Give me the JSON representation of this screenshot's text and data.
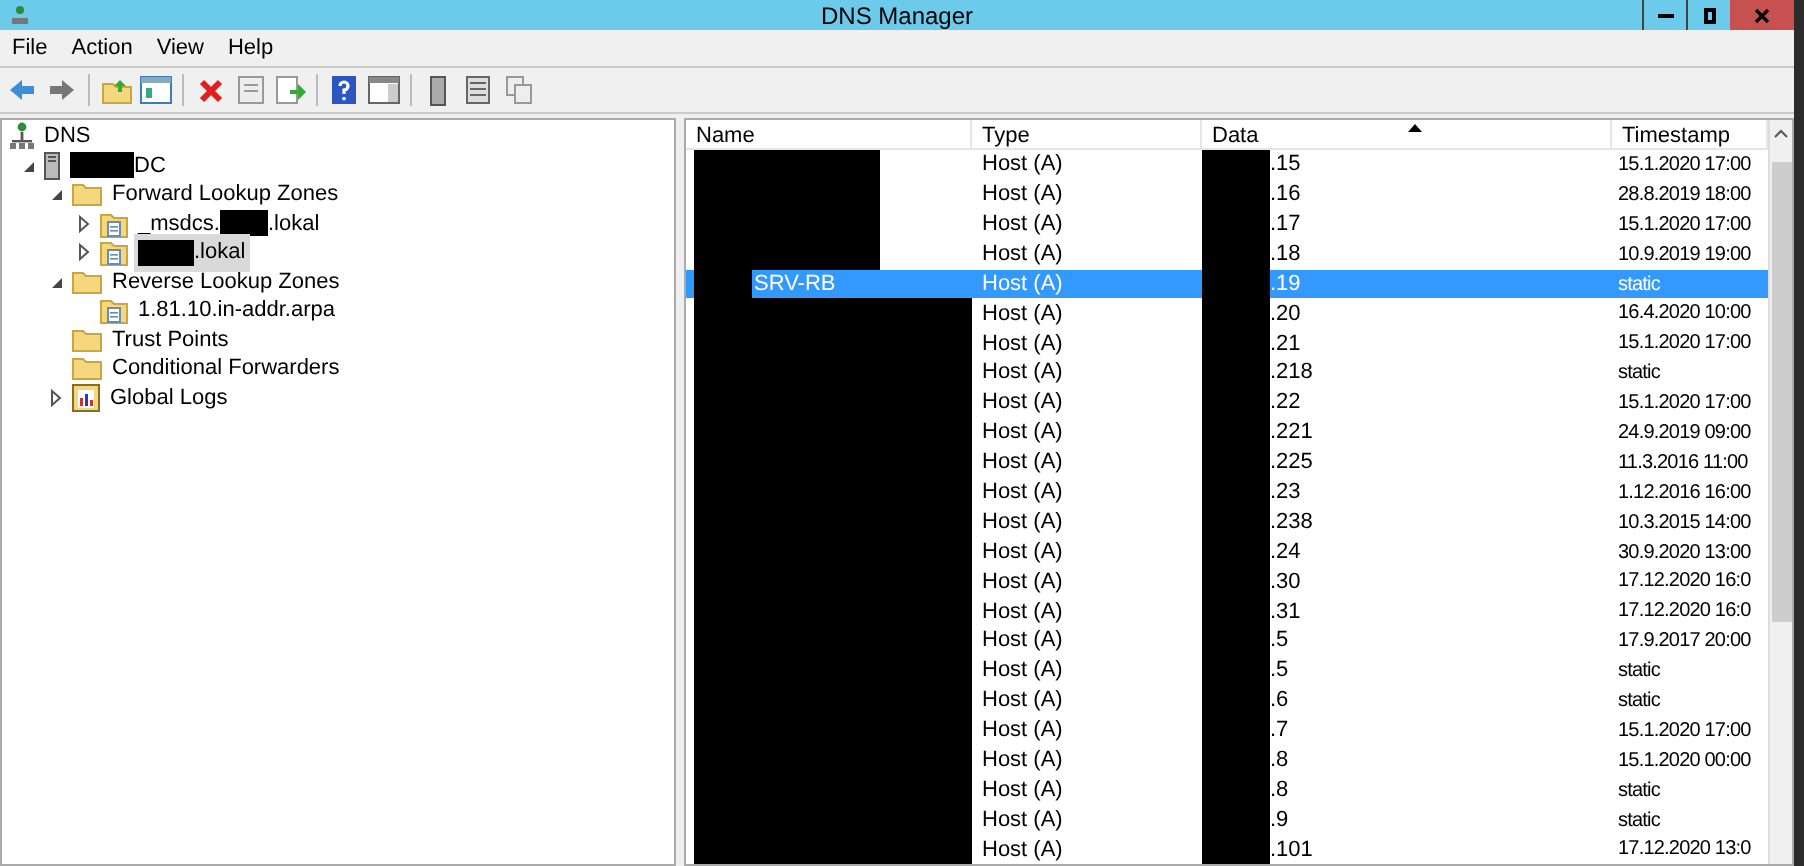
{
  "window": {
    "title": "DNS Manager"
  },
  "menu": [
    "File",
    "Action",
    "View",
    "Help"
  ],
  "tree": [
    {
      "label_parts": [
        "DNS"
      ],
      "kind": "dns",
      "redacted_start": false,
      "children": [
        {
          "label_parts": [
            "DC"
          ],
          "kind": "server",
          "redacted_start": true,
          "expanded": true,
          "children": [
            {
              "label_parts": [
                "Forward Lookup Zones"
              ],
              "kind": "folder",
              "redacted_start": false,
              "expanded": true,
              "children": [
                {
                  "label_parts": [
                    "_msdcs.",
                    ".lokal"
                  ],
                  "redacted_start": false,
                  "kind": "zone",
                  "expanded": false,
                  "selected": false
                },
                {
                  "label_parts": [
                    ".lokal"
                  ],
                  "redacted_start": true,
                  "kind": "zone",
                  "expanded": false,
                  "selected": true
                }
              ]
            },
            {
              "label_parts": [
                "Reverse Lookup Zones"
              ],
              "kind": "folder",
              "redacted_start": false,
              "expanded": true,
              "children": [
                {
                  "label_parts": [
                    "1.81.10.in-addr.arpa"
                  ],
                  "kind": "zone",
                  "redacted_start": false,
                  "selected": false
                }
              ]
            },
            {
              "label_parts": [
                "Trust Points"
              ],
              "kind": "folder",
              "redacted_start": false
            },
            {
              "label_parts": [
                "Conditional Forwarders"
              ],
              "kind": "folder",
              "redacted_start": false
            },
            {
              "label_parts": [
                "Global Logs"
              ],
              "kind": "logs",
              "redacted_start": false,
              "expanded": false
            }
          ]
        }
      ]
    }
  ],
  "table": {
    "columns": [
      "Name",
      "Type",
      "Data",
      "Timestamp"
    ],
    "rows": [
      {
        "type": "Host (A)",
        "data": ".15",
        "timestamp": "15.1.2020 17:00",
        "selected": false
      },
      {
        "type": "Host (A)",
        "data": ".16",
        "timestamp": "28.8.2019 18:00",
        "selected": false
      },
      {
        "type": "Host (A)",
        "data": ".17",
        "timestamp": "15.1.2020 17:00",
        "selected": false
      },
      {
        "type": "Host (A)",
        "data": ".18",
        "timestamp": "10.9.2019 19:00",
        "selected": false
      },
      {
        "name": "SRV-RB",
        "type": "Host (A)",
        "data": ".19",
        "timestamp": "static",
        "selected": true
      },
      {
        "type": "Host (A)",
        "data": ".20",
        "timestamp": "16.4.2020 10:00",
        "selected": false
      },
      {
        "type": "Host (A)",
        "data": ".21",
        "timestamp": "15.1.2020 17:00",
        "selected": false
      },
      {
        "type": "Host (A)",
        "data": ".218",
        "timestamp": "static",
        "selected": false
      },
      {
        "type": "Host (A)",
        "data": ".22",
        "timestamp": "15.1.2020 17:00",
        "selected": false
      },
      {
        "type": "Host (A)",
        "data": ".221",
        "timestamp": "24.9.2019 09:00",
        "selected": false
      },
      {
        "type": "Host (A)",
        "data": ".225",
        "timestamp": "11.3.2016 11:00",
        "selected": false
      },
      {
        "type": "Host (A)",
        "data": ".23",
        "timestamp": "1.12.2016 16:00",
        "selected": false
      },
      {
        "type": "Host (A)",
        "data": ".238",
        "timestamp": "10.3.2015 14:00",
        "selected": false
      },
      {
        "type": "Host (A)",
        "data": ".24",
        "timestamp": "30.9.2020 13:00",
        "selected": false
      },
      {
        "type": "Host (A)",
        "data": ".30",
        "timestamp": "17.12.2020 16:0",
        "selected": false
      },
      {
        "type": "Host (A)",
        "data": ".31",
        "timestamp": "17.12.2020 16:0",
        "selected": false
      },
      {
        "type": "Host (A)",
        "data": ".5",
        "timestamp": "17.9.2017 20:00",
        "selected": false
      },
      {
        "type": "Host (A)",
        "data": ".5",
        "timestamp": "static",
        "selected": false
      },
      {
        "type": "Host (A)",
        "data": ".6",
        "timestamp": "static",
        "selected": false
      },
      {
        "type": "Host (A)",
        "data": ".7",
        "timestamp": "15.1.2020 17:00",
        "selected": false
      },
      {
        "type": "Host (A)",
        "data": ".8",
        "timestamp": "15.1.2020 00:00",
        "selected": false
      },
      {
        "type": "Host (A)",
        "data": ".8",
        "timestamp": "static",
        "selected": false
      },
      {
        "type": "Host (A)",
        "data": ".9",
        "timestamp": "static",
        "selected": false
      },
      {
        "type": "Host (A)",
        "data": ".101",
        "timestamp": "17.12.2020 13:0",
        "selected": false
      }
    ]
  }
}
